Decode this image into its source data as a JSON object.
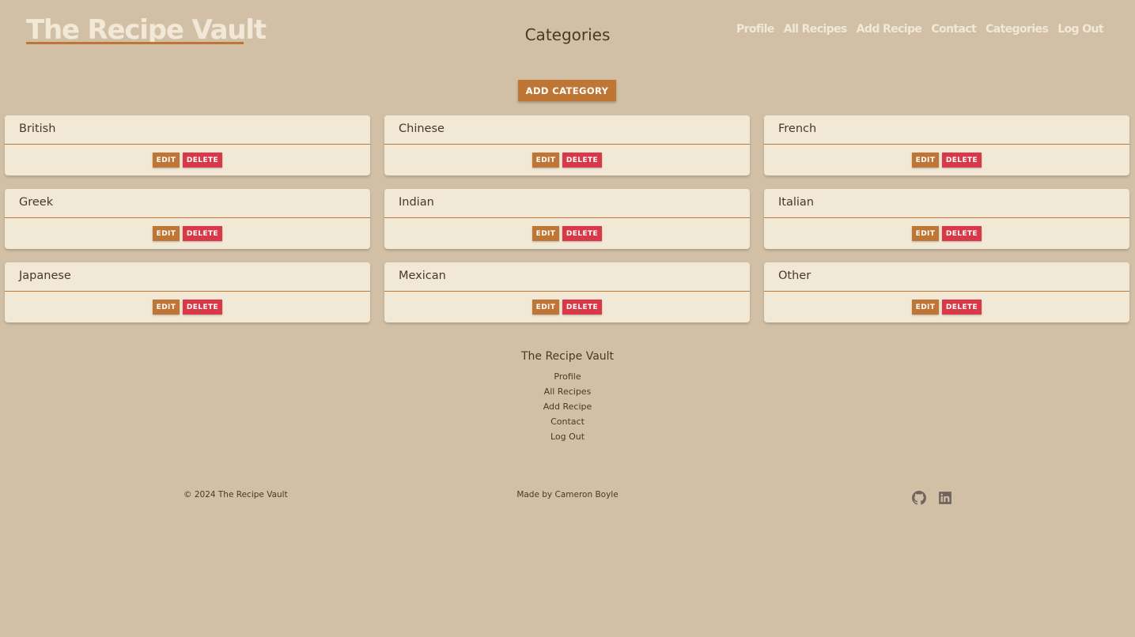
{
  "header": {
    "brand": "The Recipe Vault",
    "page_title": "Categories",
    "nav": [
      "Profile",
      "All Recipes",
      "Add Recipe",
      "Contact",
      "Categories",
      "Log Out"
    ]
  },
  "actions": {
    "add_category": "ADD CATEGORY",
    "edit": "EDIT",
    "delete": "DELETE"
  },
  "categories": [
    "British",
    "Chinese",
    "French",
    "Greek",
    "Indian",
    "Italian",
    "Japanese",
    "Mexican",
    "Other"
  ],
  "footer": {
    "title": "The Recipe Vault",
    "links": [
      "Profile",
      "All Recipes",
      "Add Recipe",
      "Contact",
      "Log Out"
    ],
    "copyright": "© 2024 The Recipe Vault",
    "made_by": "Made by Cameron Boyle",
    "social": [
      "github-icon",
      "linkedin-icon"
    ]
  },
  "colors": {
    "background": "#d2c0a6",
    "card": "#f2e8d6",
    "accent": "#bf7634",
    "danger": "#d93848",
    "text": "#4a3826",
    "header_text": "#f1e8d8"
  }
}
